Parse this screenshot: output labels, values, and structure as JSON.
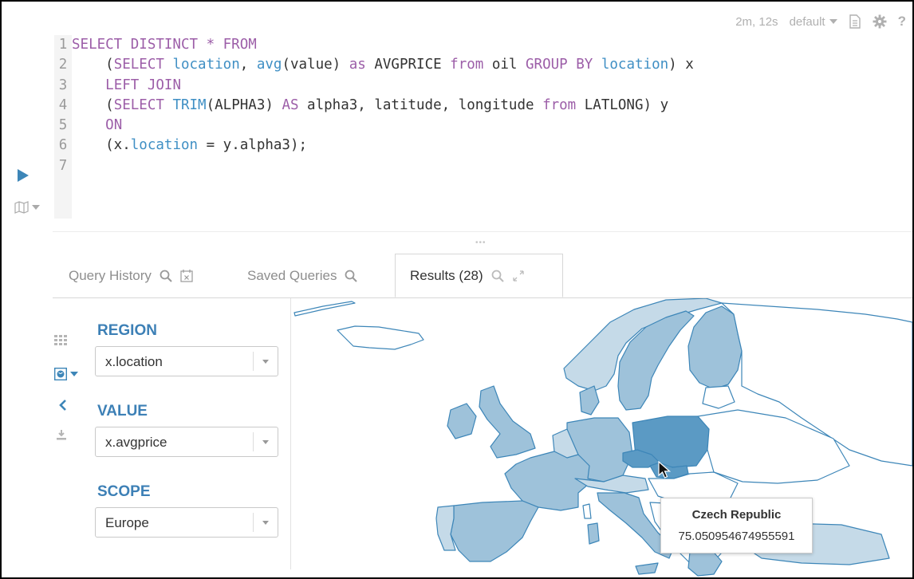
{
  "toolbar": {
    "elapsed": "2m, 12s",
    "database": "default",
    "icons": [
      "document-icon",
      "gear-icon",
      "help-icon"
    ]
  },
  "editor": {
    "lines": [
      {
        "num": "1",
        "tokens": [
          {
            "t": "SELECT DISTINCT * FROM",
            "c": "kw"
          }
        ]
      },
      {
        "num": "2",
        "tokens": [
          {
            "t": "    ("
          },
          {
            "t": "SELECT",
            "c": "kw"
          },
          {
            "t": " "
          },
          {
            "t": "location",
            "c": "fn"
          },
          {
            "t": ", "
          },
          {
            "t": "avg",
            "c": "fn"
          },
          {
            "t": "(value) "
          },
          {
            "t": "as",
            "c": "kw"
          },
          {
            "t": " AVGPRICE "
          },
          {
            "t": "from",
            "c": "kw"
          },
          {
            "t": " oil "
          },
          {
            "t": "GROUP BY",
            "c": "kw"
          },
          {
            "t": " "
          },
          {
            "t": "location",
            "c": "fn"
          },
          {
            "t": ") x"
          }
        ]
      },
      {
        "num": "3",
        "tokens": [
          {
            "t": "    "
          },
          {
            "t": "LEFT JOIN",
            "c": "kw"
          }
        ]
      },
      {
        "num": "4",
        "tokens": [
          {
            "t": "    ("
          },
          {
            "t": "SELECT",
            "c": "kw"
          },
          {
            "t": " "
          },
          {
            "t": "TRIM",
            "c": "fn"
          },
          {
            "t": "(ALPHA3) "
          },
          {
            "t": "AS",
            "c": "kw"
          },
          {
            "t": " alpha3, latitude, longitude "
          },
          {
            "t": "from",
            "c": "kw"
          },
          {
            "t": " LATLONG) y"
          }
        ]
      },
      {
        "num": "5",
        "tokens": [
          {
            "t": "    "
          },
          {
            "t": "ON",
            "c": "kw"
          }
        ]
      },
      {
        "num": "6",
        "tokens": [
          {
            "t": "    (x."
          },
          {
            "t": "location",
            "c": "fn"
          },
          {
            "t": " = y.alpha3);"
          }
        ]
      },
      {
        "num": "7",
        "tokens": []
      }
    ]
  },
  "tabs": {
    "query_history": "Query History",
    "saved_queries": "Saved Queries",
    "results": "Results (28)"
  },
  "chart_settings": {
    "region_label": "REGION",
    "region_value": "x.location",
    "value_label": "VALUE",
    "value_value": "x.avgprice",
    "scope_label": "SCOPE",
    "scope_value": "Europe"
  },
  "map": {
    "colors": {
      "light": "#c5dae8",
      "mid": "#9ec2da",
      "dark": "#5b9ac4",
      "border": "#3d86b8",
      "empty": "#ffffff"
    }
  },
  "tooltip": {
    "title": "Czech Republic",
    "value": "75.050954674955591"
  }
}
